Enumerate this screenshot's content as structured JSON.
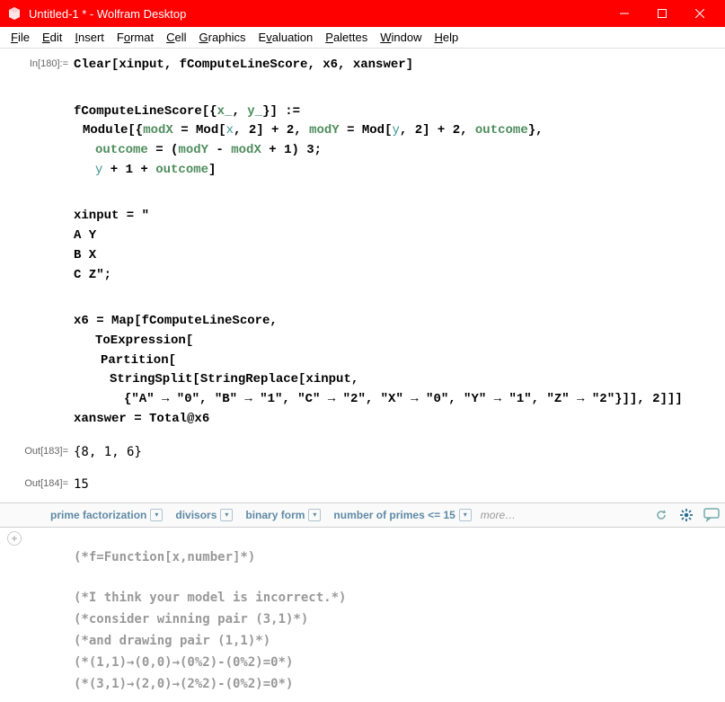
{
  "titlebar": {
    "title": "Untitled-1 * - Wolfram Desktop"
  },
  "menubar": {
    "file": "File",
    "edit": "Edit",
    "insert": "Insert",
    "format": "Format",
    "cell": "Cell",
    "graphics": "Graphics",
    "evaluation": "Evaluation",
    "palettes": "Palettes",
    "window": "Window",
    "help": "Help"
  },
  "labels": {
    "in180": "In[180]:=",
    "out183": "Out[183]=",
    "out184": "Out[184]="
  },
  "code": {
    "l1": "Clear[xinput, fComputeLineScore, x6, xanswer]",
    "b2": {
      "l1a": "fComputeLineScore[{",
      "l1b": "x_",
      "l1c": ", ",
      "l1d": "y_",
      "l1e": "}] :=",
      "l2a": "Module[{",
      "l2b": "modX",
      "l2c": " = Mod[",
      "l2d": "x",
      "l2e": ", 2] + 2, ",
      "l2f": "modY",
      "l2g": " = Mod[",
      "l2h": "y",
      "l2i": ", 2] + 2, ",
      "l2j": "outcome",
      "l2k": "},",
      "l3a": "outcome",
      "l3b": " = (",
      "l3c": "modY",
      "l3d": " - ",
      "l3e": "modX",
      "l3f": " + 1)  3;",
      "l4a": "y",
      "l4b": " + 1 + ",
      "l4c": "outcome",
      "l4d": "]"
    },
    "b3": {
      "l1": "xinput = \"",
      "l2": "A Y",
      "l3": "B X",
      "l4": "C Z\";"
    },
    "b4": {
      "l1": "x6 = Map[fComputeLineScore,",
      "l2": "ToExpression[",
      "l3": "Partition[",
      "l4": "StringSplit[StringReplace[xinput,",
      "l5": "{\"A\" → \"0\", \"B\" → \"1\", \"C\" → \"2\", \"X\" → \"0\", \"Y\" → \"1\", \"Z\" → \"2\"}]], 2]]]",
      "l6": "xanswer = Total@x6"
    }
  },
  "output": {
    "o183": "{8, 1, 6}",
    "o184": "15"
  },
  "suggest": {
    "s1": "prime factorization",
    "s2": "divisors",
    "s3": "binary form",
    "s4": "number of primes <= 15",
    "more": "more…"
  },
  "comments": {
    "c1": "(*f=Function[x,number]*)",
    "c2": "(*I think your model is incorrect.*)",
    "c3": "(*consider winning pair (3,1)*)",
    "c4": "(*and drawing pair (1,1)*)",
    "c5": "(*(1,1)→(0,0)→(0%2)-(0%2)=0*)",
    "c6": "(*(3,1)→(2,0)→(2%2)-(0%2)=0*)"
  }
}
